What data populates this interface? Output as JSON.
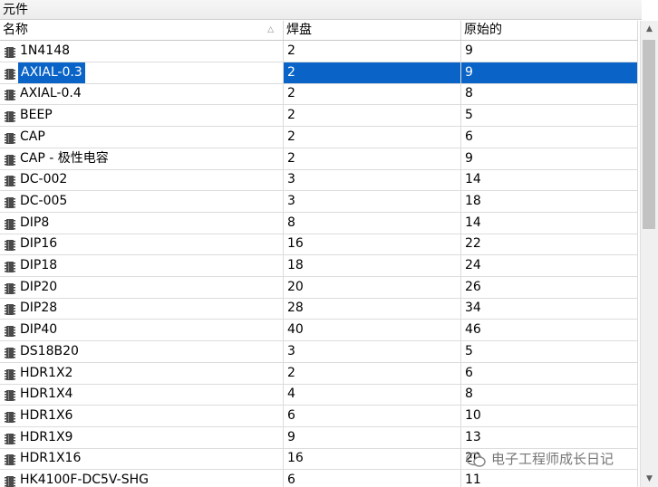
{
  "panel": {
    "title": "元件"
  },
  "columns": {
    "name": "名称",
    "pads": "焊盘",
    "original": "原始的"
  },
  "rows": [
    {
      "name": "1N4148",
      "pads": "2",
      "original": "9"
    },
    {
      "name": "AXIAL-0.3",
      "pads": "2",
      "original": "9",
      "selected": true
    },
    {
      "name": "AXIAL-0.4",
      "pads": "2",
      "original": "8"
    },
    {
      "name": "BEEP",
      "pads": "2",
      "original": "5"
    },
    {
      "name": "CAP",
      "pads": "2",
      "original": "6"
    },
    {
      "name": "CAP - 极性电容",
      "pads": "2",
      "original": "9"
    },
    {
      "name": "DC-002",
      "pads": "3",
      "original": "14"
    },
    {
      "name": "DC-005",
      "pads": "3",
      "original": "18"
    },
    {
      "name": "DIP8",
      "pads": "8",
      "original": "14"
    },
    {
      "name": "DIP16",
      "pads": "16",
      "original": "22"
    },
    {
      "name": "DIP18",
      "pads": "18",
      "original": "24"
    },
    {
      "name": "DIP20",
      "pads": "20",
      "original": "26"
    },
    {
      "name": "DIP28",
      "pads": "28",
      "original": "34"
    },
    {
      "name": "DIP40",
      "pads": "40",
      "original": "46"
    },
    {
      "name": "DS18B20",
      "pads": "3",
      "original": "5"
    },
    {
      "name": "HDR1X2",
      "pads": "2",
      "original": "6"
    },
    {
      "name": "HDR1X4",
      "pads": "4",
      "original": "8"
    },
    {
      "name": "HDR1X6",
      "pads": "6",
      "original": "10"
    },
    {
      "name": "HDR1X9",
      "pads": "9",
      "original": "13"
    },
    {
      "name": "HDR1X16",
      "pads": "16",
      "original": "20"
    },
    {
      "name": "HK4100F-DC5V-SHG",
      "pads": "6",
      "original": "11"
    }
  ],
  "watermark": {
    "text": "电子工程师成长日记"
  },
  "colors": {
    "selection": "#0a64c8"
  }
}
